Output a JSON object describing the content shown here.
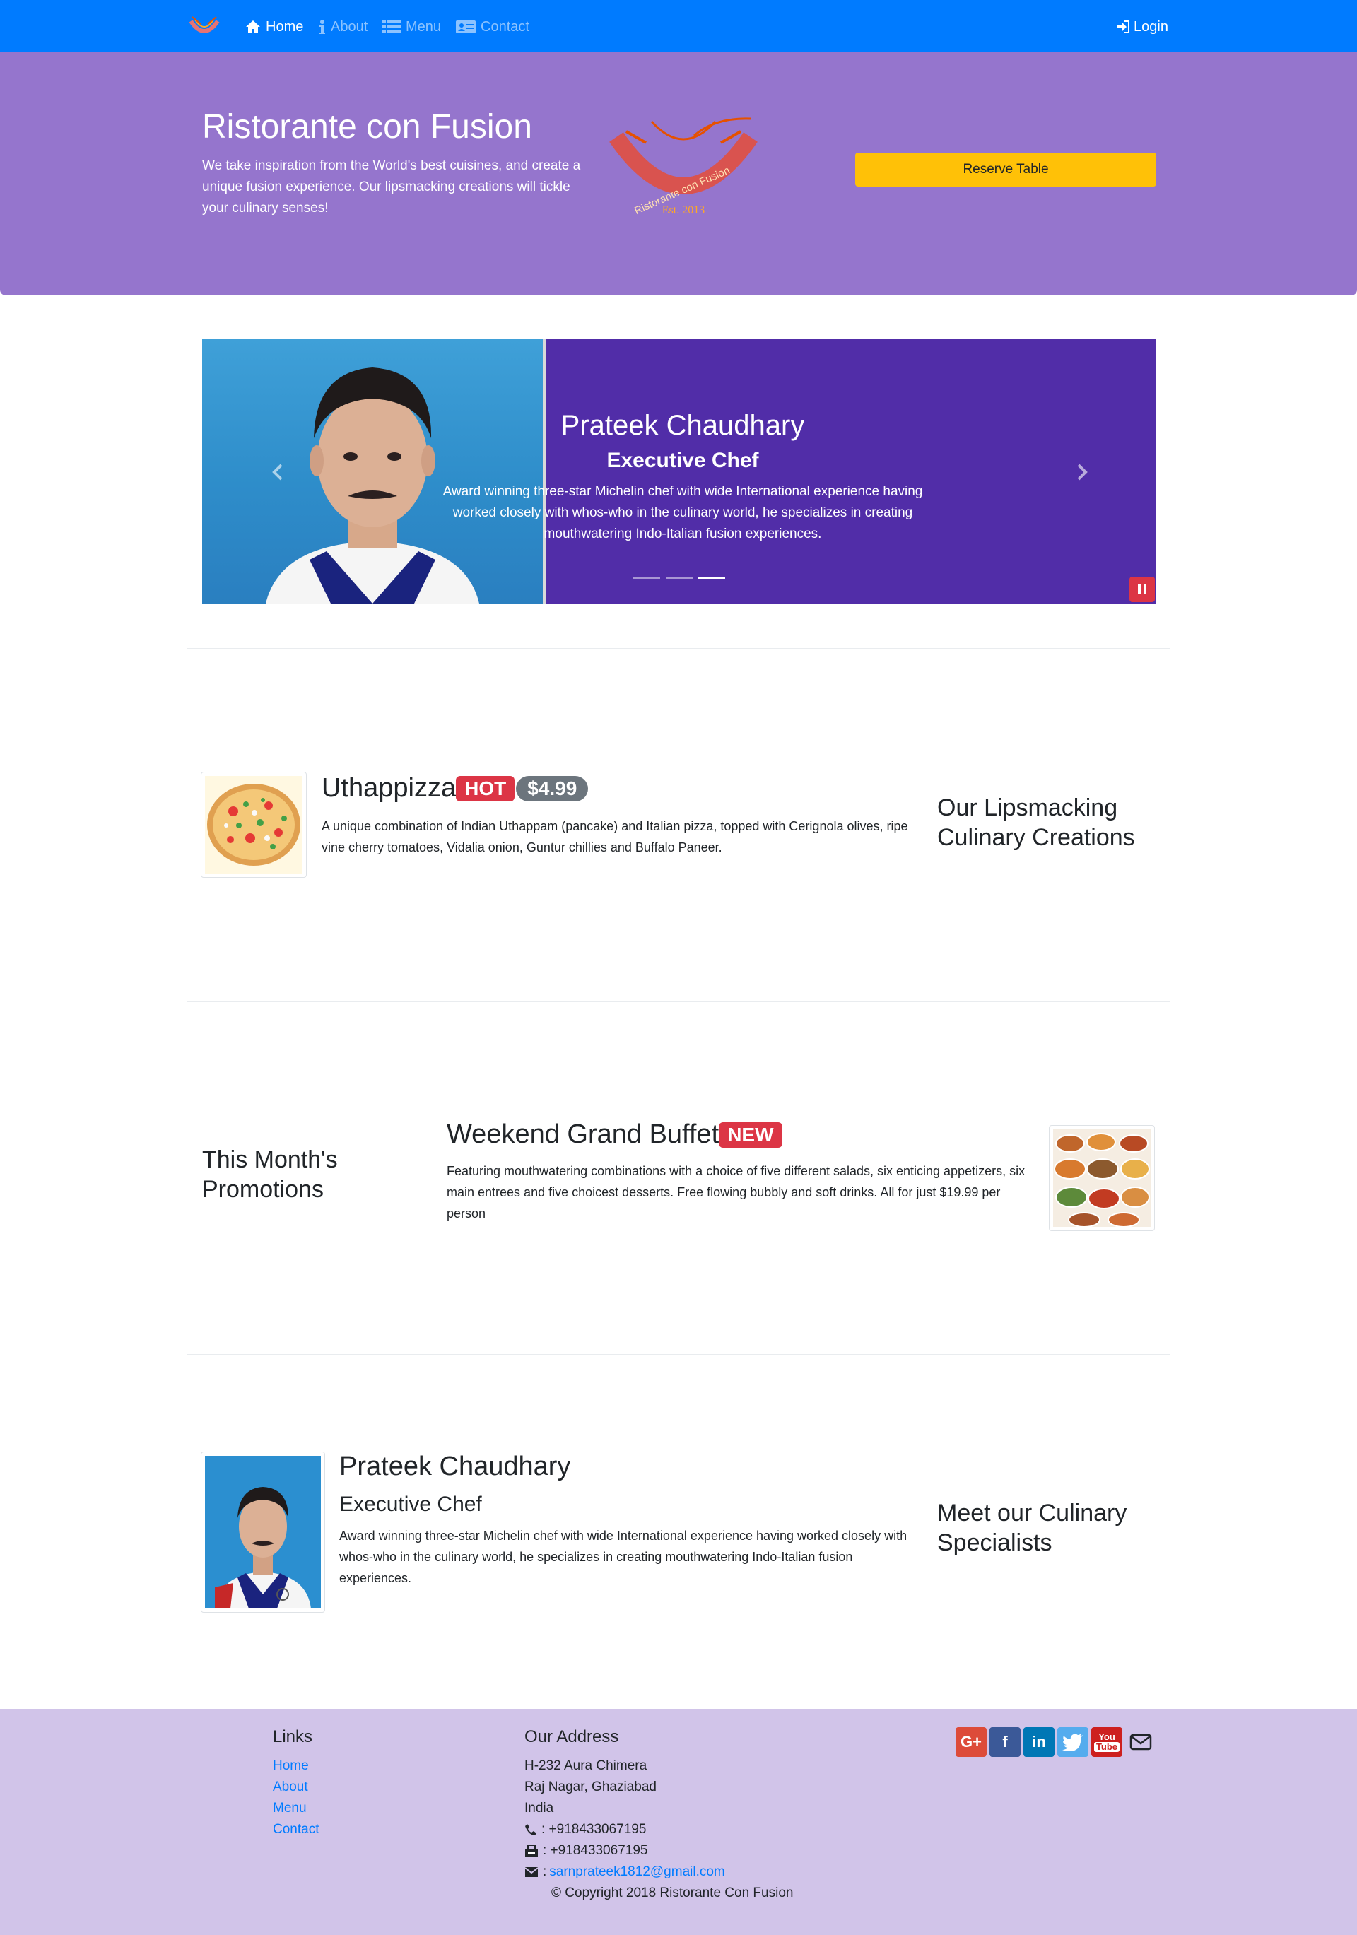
{
  "nav": {
    "home": "Home",
    "about": "About",
    "menu": "Menu",
    "contact": "Contact",
    "login": "Login"
  },
  "jumbotron": {
    "title": "Ristorante con Fusion",
    "text": "We take inspiration from the World's best cuisines, and create a unique fusion experience. Our lipsmacking creations will tickle your culinary senses!",
    "logo_text": "Ristorante con Fusion",
    "logo_est": "Est. 2013",
    "reserve_label": "Reserve Table"
  },
  "carousel": {
    "name": "Prateek Chaudhary",
    "role": "Executive Chef",
    "description": "Award winning three-star Michelin chef with wide International experience having worked closely with whos-who in the culinary world, he specializes in creating mouthwatering Indo-Italian fusion experiences.",
    "active_slide": 3,
    "slide_count": 3
  },
  "dish": {
    "name": "Uthappizza",
    "badge": "HOT",
    "price": "$4.99",
    "description": "A unique combination of Indian Uthappam (pancake) and Italian pizza, topped with Cerignola olives, ripe vine cherry tomatoes, Vidalia onion, Guntur chillies and Buffalo Paneer.",
    "side_heading_1": "Our Lipsmacking",
    "side_heading_2": "Culinary Creations"
  },
  "promotion": {
    "side_heading_1": "This Month's",
    "side_heading_2": "Promotions",
    "name": "Weekend Grand Buffet",
    "badge": "NEW",
    "description": "Featuring mouthwatering combinations with a choice of five different salads, six enticing appetizers, six main entrees and five choicest desserts. Free flowing bubbly and soft drinks. All for just $19.99 per person"
  },
  "leader": {
    "name": "Prateek Chaudhary",
    "role": "Executive Chef",
    "description": "Award winning three-star Michelin chef with wide International experience having worked closely with whos-who in the culinary world, he specializes in creating mouthwatering Indo-Italian fusion experiences.",
    "side_heading_1": "Meet our Culinary",
    "side_heading_2": "Specialists"
  },
  "footer": {
    "links_heading": "Links",
    "links": [
      "Home",
      "About",
      "Menu",
      "Contact"
    ],
    "address_heading": "Our Address",
    "address": [
      "H-232 Aura Chimera",
      "Raj Nagar, Ghaziabad",
      "India"
    ],
    "phone": ": +918433067195",
    "fax": ": +918433067195",
    "email": "sarnprateek1812@gmail.com",
    "email_prefix": ":",
    "social": {
      "google": "G+",
      "facebook": "f",
      "linkedin": "in",
      "youtube_top": "You",
      "youtube_bottom": "Tube"
    },
    "copyright": "© Copyright 2018 Ristorante Con Fusion"
  },
  "colors": {
    "navbar": "#007bff",
    "jumbotron": "#9575cd",
    "carousel": "#512da8",
    "reserve": "#ffc107",
    "badge_danger": "#dc3545",
    "footer": "#d1c4e9"
  }
}
